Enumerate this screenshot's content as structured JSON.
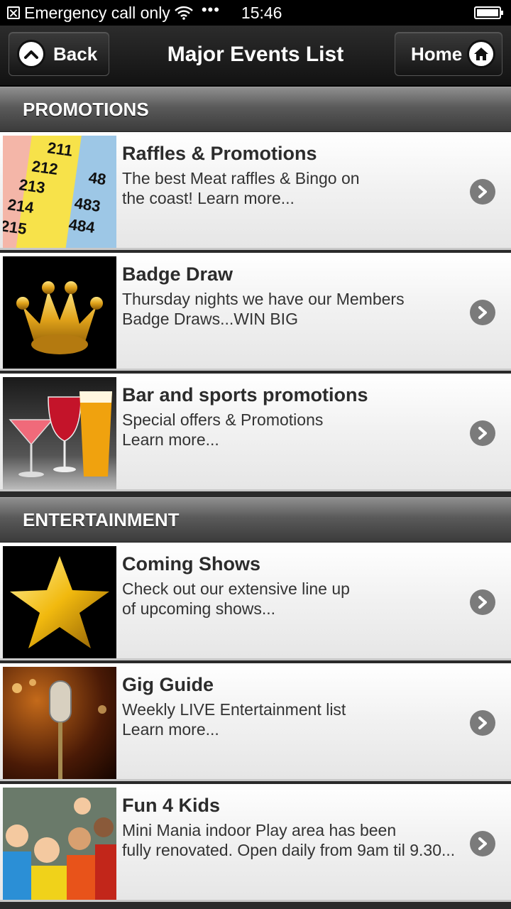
{
  "status_bar": {
    "carrier_text": "Emergency call only",
    "dots": "•••",
    "time": "15:46"
  },
  "header": {
    "back_label": "Back",
    "title": "Major Events List",
    "home_label": "Home"
  },
  "sections": [
    {
      "label": "PROMOTIONS",
      "items": [
        {
          "title": "Raffles & Promotions",
          "line1": "The best Meat raffles & Bingo on",
          "line2": "the coast! Learn more..."
        },
        {
          "title": "Badge Draw",
          "line1": "Thursday nights we have our Members",
          "line2": "Badge Draws...WIN BIG"
        },
        {
          "title": "Bar and sports promotions",
          "line1": "Special offers & Promotions",
          "line2": "Learn more..."
        }
      ]
    },
    {
      "label": "ENTERTAINMENT",
      "items": [
        {
          "title": "Coming Shows",
          "line1": "Check out our extensive line up",
          "line2": "of upcoming shows..."
        },
        {
          "title": "Gig Guide",
          "line1": "Weekly LIVE Entertainment list",
          "line2": "Learn more..."
        },
        {
          "title": "Fun 4 Kids",
          "line1": "Mini Mania indoor Play area has been",
          "line2": "fully renovated. Open daily from 9am til 9.30..."
        }
      ]
    }
  ],
  "raffle_ticket_numbers": [
    "211",
    "212",
    "213",
    "214",
    "215",
    "483",
    "484",
    "48"
  ],
  "icons": {
    "back": "chevron-up-icon",
    "home": "home-icon",
    "row_action": "chevron-right-icon"
  }
}
